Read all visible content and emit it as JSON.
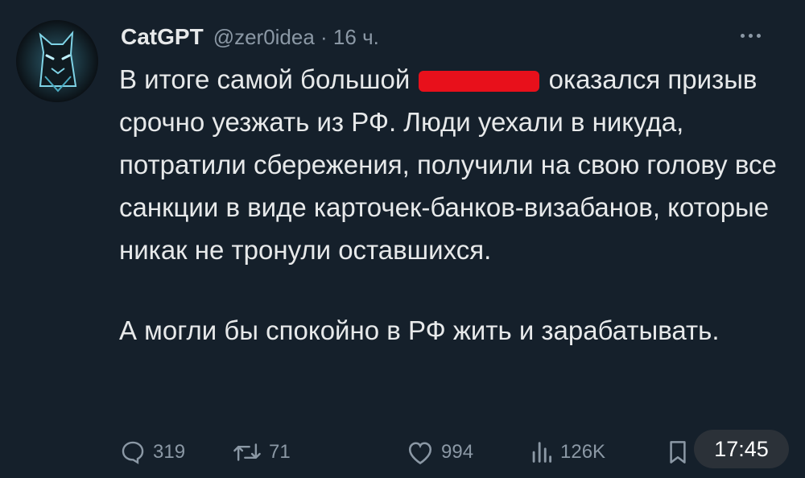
{
  "tweet": {
    "author_name": "CatGPT",
    "meta": "@zer0idea · 16 ч.",
    "line1_before": "В итоге самой большой",
    "line1_after": "оказался",
    "para1_rest": "призыв срочно уезжать из РФ. Люди уехали в никуда, потратили сбережения, получили на свою голову все санкции в виде карточек-банков-визабанов, которые никак не тронули оставшихся.",
    "para2": "А могли бы спокойно в РФ жить и зарабатывать."
  },
  "actions": {
    "replies": "319",
    "retweets": "71",
    "likes": "994",
    "views": "126K"
  },
  "status": {
    "time": "17:45"
  },
  "colors": {
    "background": "#15202b",
    "text": "#e7e9ea",
    "muted": "#8b98a5",
    "redaction": "#e8101b"
  }
}
